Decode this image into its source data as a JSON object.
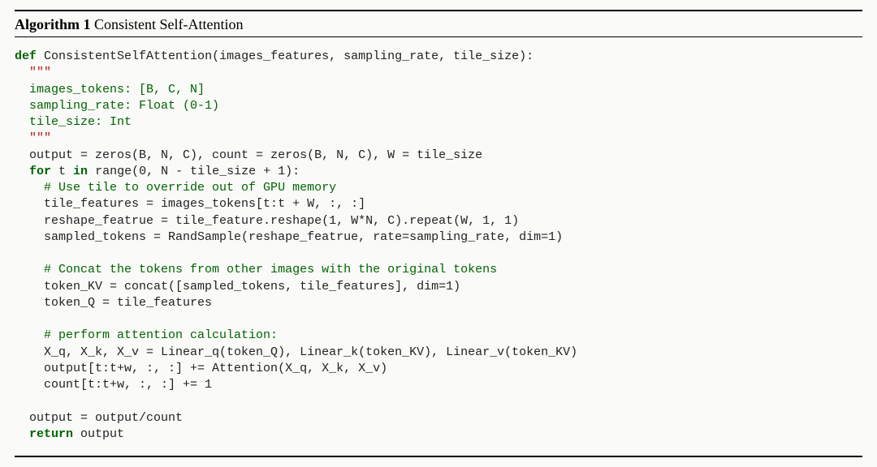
{
  "algorithm": {
    "label": "Algorithm 1",
    "title": "Consistent Self-Attention"
  },
  "code": {
    "def_kw": "def",
    "fn_name": "ConsistentSelfAttention",
    "params": "(images_features, sampling_rate, tile_size):",
    "doc_open": "\"\"\"",
    "doc_l1": "images_tokens: [B, C, N]",
    "doc_l2": "sampling_rate: Float (0-1)",
    "doc_l3": "tile_size: Int",
    "doc_close": "\"\"\"",
    "l_init": "output = zeros(B, N, C), count = zeros(B, N, C), W = tile_size",
    "for_kw": "for",
    "in_kw": "in",
    "for_var": " t ",
    "for_iter": " range(0, N - tile_size + 1):",
    "cmt1": "# Use tile to override out of GPU memory",
    "l_tile": "tile_features = images_tokens[t:t + W, :, :]",
    "l_reshape": "reshape_featrue = tile_feature.reshape(1, W*N, C).repeat(W, 1, 1)",
    "l_sample": "sampled_tokens = RandSample(reshape_featrue, rate=sampling_rate, dim=1)",
    "cmt2": "# Concat the tokens from other images with the original tokens",
    "l_kv": "token_KV = concat([sampled_tokens, tile_features], dim=1)",
    "l_q": "token_Q = tile_features",
    "cmt3": "# perform attention calculation:",
    "l_lin": "X_q, X_k, X_v = Linear_q(token_Q), Linear_k(token_KV), Linear_v(token_KV)",
    "l_out": "output[t:t+w, :, :] += Attention(X_q, X_k, X_v)",
    "l_cnt": "count[t:t+w, :, :] += 1",
    "l_div": "output = output/count",
    "return_kw": "return",
    "return_val": " output"
  }
}
